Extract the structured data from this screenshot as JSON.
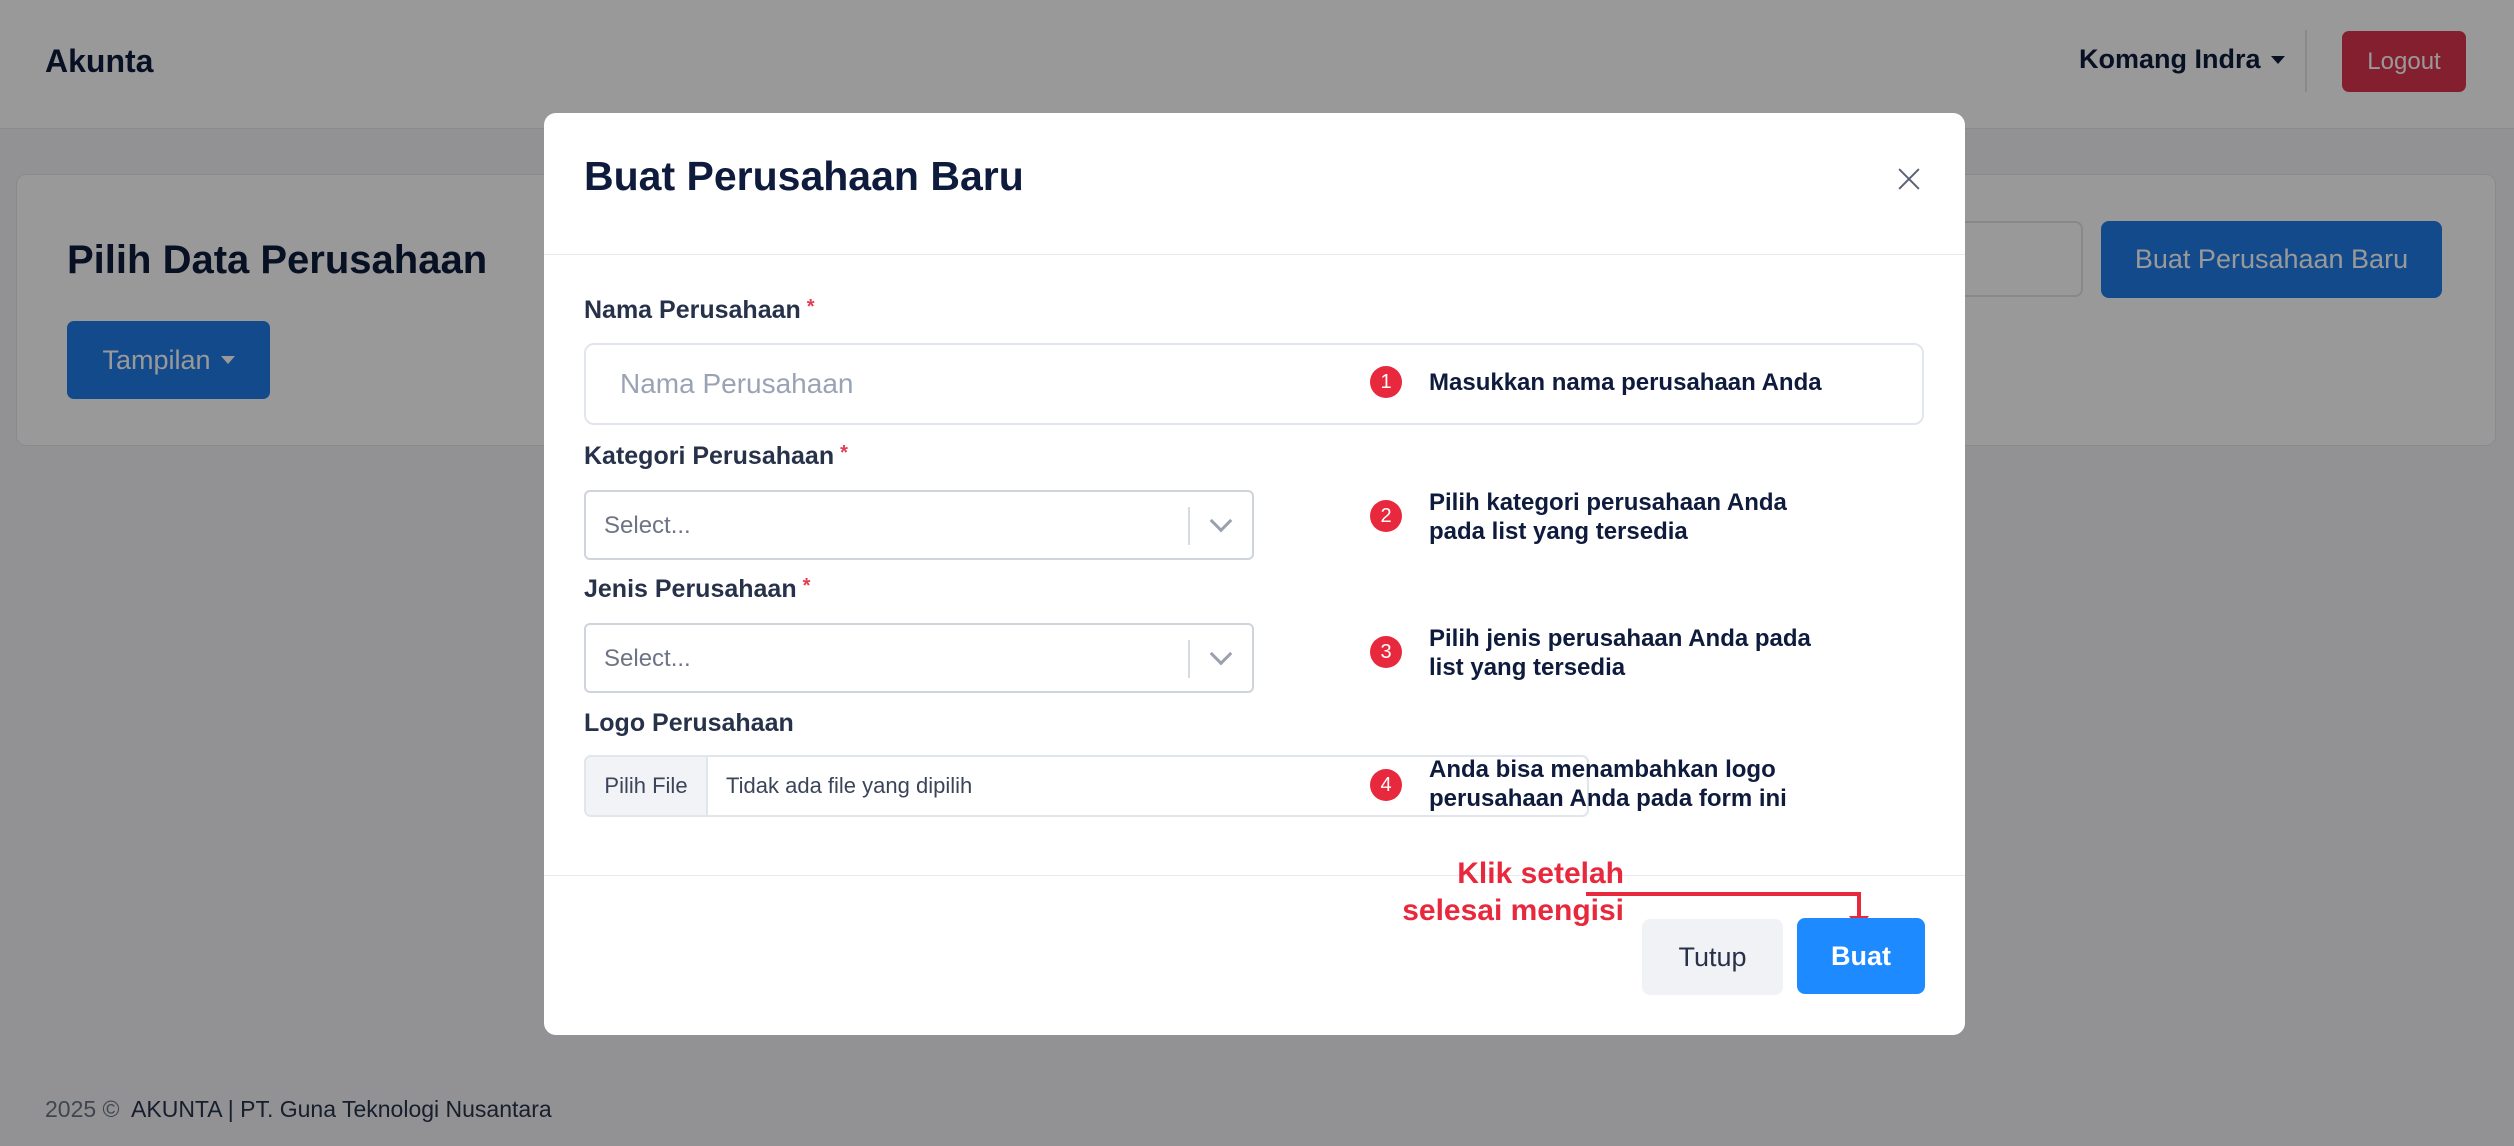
{
  "navbar": {
    "brand": "Akunta",
    "user_name": "Komang Indra",
    "logout_label": "Logout"
  },
  "page": {
    "title": "Pilih Data Perusahaan",
    "view_button_label": "Tampilan",
    "new_company_button_label": "Buat Perusahaan Baru"
  },
  "footer": {
    "year": "2025 ©",
    "text": "AKUNTA | PT. Guna Teknologi Nusantara"
  },
  "modal": {
    "title": "Buat Perusahaan Baru",
    "fields": {
      "company_name": {
        "label": "Nama Perusahaan",
        "required_mark": "*",
        "placeholder": "Nama Perusahaan"
      },
      "company_category": {
        "label": "Kategori Perusahaan",
        "required_mark": "*",
        "placeholder": "Select..."
      },
      "company_type": {
        "label": "Jenis Perusahaan",
        "required_mark": "*",
        "placeholder": "Select..."
      },
      "company_logo": {
        "label": "Logo Perusahaan",
        "button_label": "Pilih File",
        "status": "Tidak ada file yang dipilih"
      }
    },
    "close_button_label": "Tutup",
    "submit_button_label": "Buat"
  },
  "annotations": {
    "steps": [
      {
        "number": "1",
        "text": "Masukkan nama perusahaan Anda"
      },
      {
        "number": "2",
        "line1": "Pilih kategori perusahaan Anda",
        "line2": "pada list yang tersedia"
      },
      {
        "number": "3",
        "line1": "Pilih jenis perusahaan Anda pada",
        "line2": "list yang tersedia"
      },
      {
        "number": "4",
        "line1": "Anda bisa menambahkan logo",
        "line2": "perusahaan Anda pada form ini"
      }
    ],
    "submit_hint_line1": "Klik setelah",
    "submit_hint_line2": "selesai mengisi"
  },
  "colors": {
    "primary": "#1f7ce8",
    "submit": "#1e8aff",
    "danger": "#dc3450",
    "annotation_red": "#e8283c",
    "overlay": "rgba(0,0,0,0.40)"
  }
}
